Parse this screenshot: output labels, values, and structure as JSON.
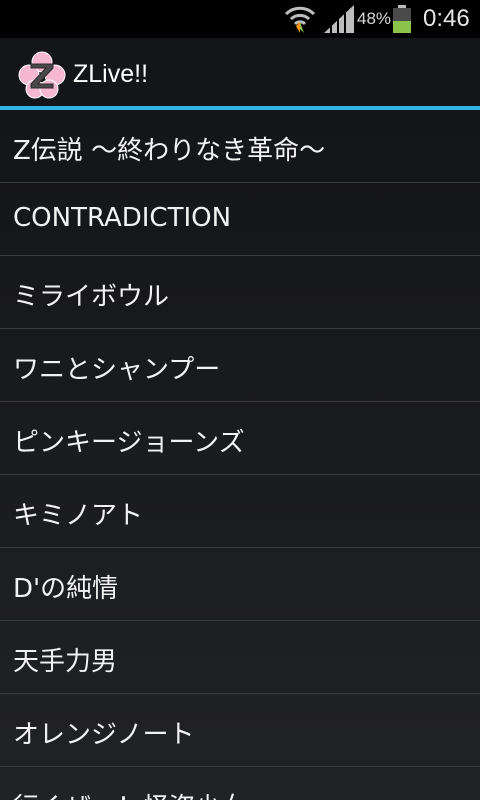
{
  "status_bar": {
    "battery_percent": "48%",
    "battery_level": 0.48,
    "time": "0:46",
    "icons": [
      "wifi-icon",
      "signal-icon",
      "battery-icon"
    ],
    "battery_color": "#8bc34a"
  },
  "action_bar": {
    "title": "ZLive!!",
    "icon": "app-logo-icon",
    "accent_color": "#33b5e5"
  },
  "songs": [
    "Z伝説 ～終わりなき革命～",
    "CONTRADICTION",
    "ミライボウル",
    "ワニとシャンプー",
    "ピンキージョーンズ",
    "キミノアト",
    "D'の純情",
    "天手力男",
    "オレンジノート",
    "行くぜっ！怪盗少女"
  ]
}
